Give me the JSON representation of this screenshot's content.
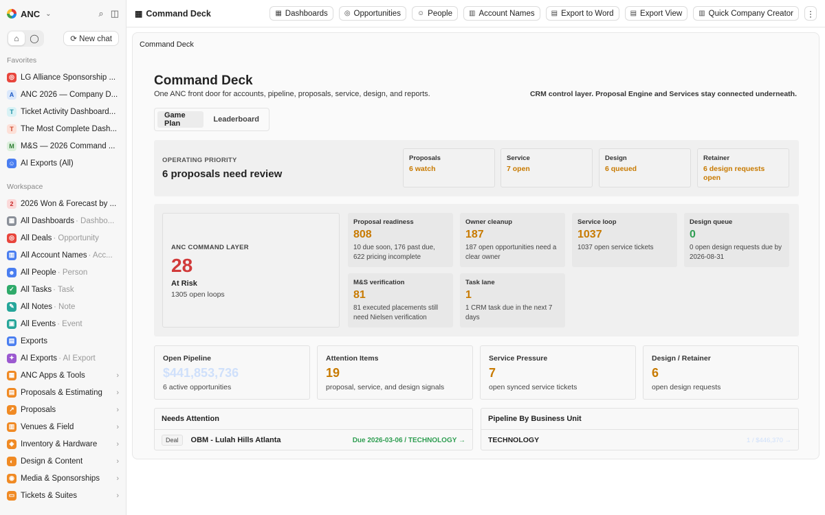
{
  "sidebar": {
    "workspace": "ANC",
    "new_chat": "New chat",
    "favorites_label": "Favorites",
    "favorites": [
      {
        "label": "LG Alliance Sponsorship ...",
        "icon": "target-icon"
      },
      {
        "label": "ANC 2026 — Company D...",
        "icon": "letter-a-icon"
      },
      {
        "label": "Ticket Activity Dashboard...",
        "icon": "letter-t-icon"
      },
      {
        "label": "The Most Complete Dash...",
        "icon": "letter-t-icon"
      },
      {
        "label": "M&S — 2026 Command ...",
        "icon": "letter-m-icon"
      },
      {
        "label": "AI Exports (All)",
        "icon": "robot-icon"
      }
    ],
    "workspace_label": "Workspace",
    "workspace_items": [
      {
        "label": "2026 Won & Forecast by ...",
        "sub": ""
      },
      {
        "label": "All Dashboards",
        "sub": "· Dashbo..."
      },
      {
        "label": "All Deals",
        "sub": "· Opportunity"
      },
      {
        "label": "All Account Names",
        "sub": "· Acc..."
      },
      {
        "label": "All People",
        "sub": "· Person"
      },
      {
        "label": "All Tasks",
        "sub": "· Task"
      },
      {
        "label": "All Notes",
        "sub": "· Note"
      },
      {
        "label": "All Events",
        "sub": "· Event"
      },
      {
        "label": "Exports",
        "sub": ""
      },
      {
        "label": "AI Exports",
        "sub": "· AI Export"
      },
      {
        "label": "ANC Apps & Tools",
        "sub": ""
      },
      {
        "label": "Proposals & Estimating",
        "sub": ""
      },
      {
        "label": "Proposals",
        "sub": ""
      },
      {
        "label": "Venues & Field",
        "sub": ""
      },
      {
        "label": "Inventory & Hardware",
        "sub": ""
      },
      {
        "label": "Design & Content",
        "sub": ""
      },
      {
        "label": "Media & Sponsorships",
        "sub": ""
      },
      {
        "label": "Tickets & Suites",
        "sub": ""
      }
    ]
  },
  "topbar": {
    "title": "Command Deck",
    "buttons": [
      "Dashboards",
      "Opportunities",
      "People",
      "Account Names",
      "Export to Word",
      "Export View",
      "Quick Company Creator"
    ]
  },
  "page": {
    "breadcrumb": "Command Deck",
    "title": "Command Deck",
    "subtitle": "One ANC front door for accounts, pipeline, proposals, service, design, and reports.",
    "note": "CRM control layer. Proposal Engine and Services stay connected underneath.",
    "tabs": [
      "Game Plan",
      "Leaderboard"
    ]
  },
  "operating": {
    "label": "OPERATING PRIORITY",
    "value": "6 proposals need review",
    "cards": [
      {
        "label": "Proposals",
        "value": "6 watch"
      },
      {
        "label": "Service",
        "value": "7 open"
      },
      {
        "label": "Design",
        "value": "6 queued"
      },
      {
        "label": "Retainer",
        "value": "6 design requests open"
      }
    ]
  },
  "command": {
    "label": "ANC COMMAND LAYER",
    "number": "28",
    "status": "At Risk",
    "sub": "1305 open loops",
    "cards": [
      {
        "label": "Proposal readiness",
        "value": "808",
        "desc": "10 due soon, 176 past due, 622 pricing incomplete"
      },
      {
        "label": "Owner cleanup",
        "value": "187",
        "desc": "187 open opportunities need a clear owner"
      },
      {
        "label": "Service loop",
        "value": "1037",
        "desc": "1037 open service tickets"
      },
      {
        "label": "Design queue",
        "value": "0",
        "desc": "0 open design requests due by 2026-08-31"
      },
      {
        "label": "M&S verification",
        "value": "81",
        "desc": "81 executed placements still need Nielsen verification"
      },
      {
        "label": "Task lane",
        "value": "1",
        "desc": "1 CRM task due in the next 7 days"
      }
    ]
  },
  "stats": [
    {
      "label": "Open Pipeline",
      "value": "$441,853,736",
      "sub": "6 active opportunities"
    },
    {
      "label": "Attention Items",
      "value": "19",
      "sub": "proposal, service, and design signals"
    },
    {
      "label": "Service Pressure",
      "value": "7",
      "sub": "open synced service tickets"
    },
    {
      "label": "Design / Retainer",
      "value": "6",
      "sub": "open design requests"
    }
  ],
  "needs_attention": {
    "title": "Needs Attention",
    "row": {
      "tag": "Deal",
      "name": "OBM - Lulah Hills Atlanta",
      "due": "Due 2026-03-06 / TECHNOLOGY →"
    }
  },
  "pipeline_bu": {
    "title": "Pipeline By Business Unit",
    "row": {
      "unit": "TECHNOLOGY",
      "value": "1 / $446,370 →"
    }
  },
  "colors": {
    "accent": "#c87a00",
    "risk": "#d13a3a",
    "ok": "#2f9e52",
    "pale": "#cfe0fb"
  }
}
